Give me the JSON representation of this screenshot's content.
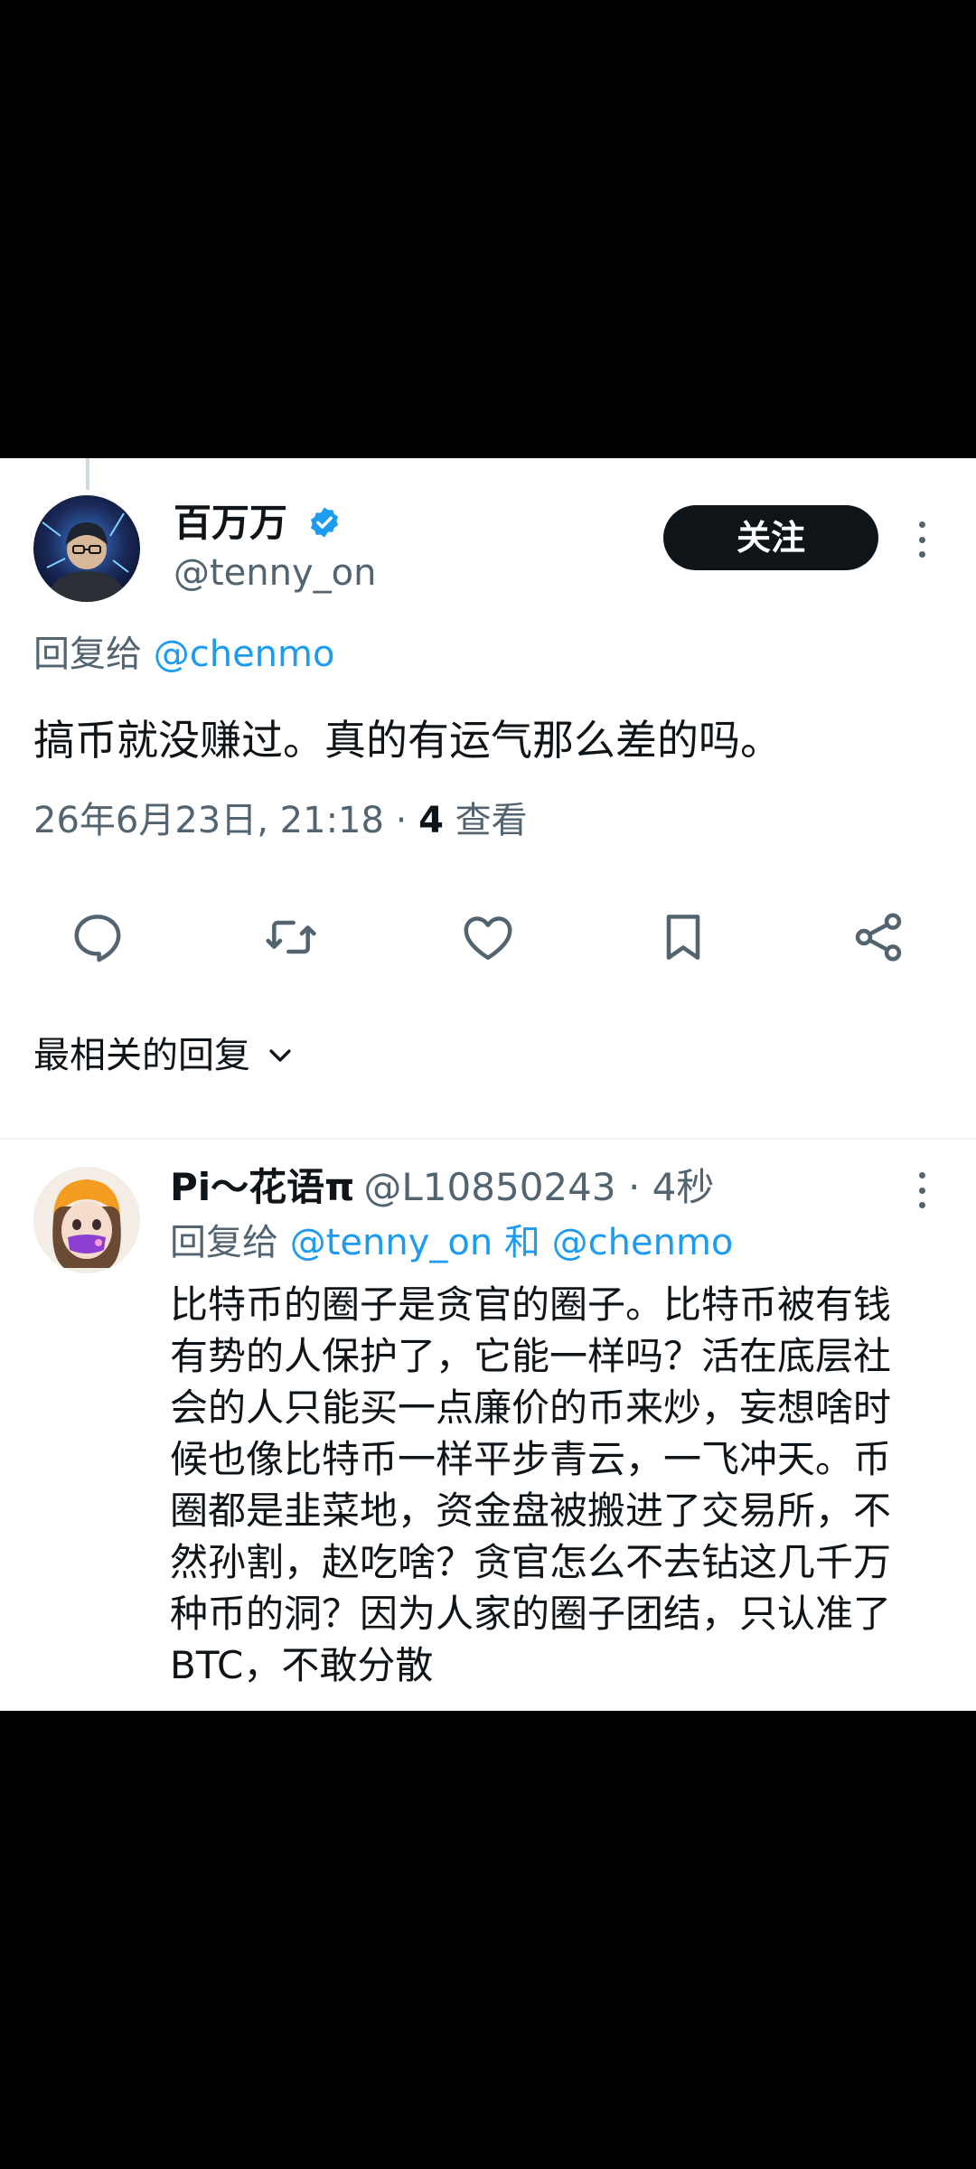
{
  "tweet": {
    "display_name": "百万万",
    "handle": "@tenny_on",
    "follow_label": "关注",
    "reply_to_prefix": "回复给",
    "reply_to_handle": "@chenmo",
    "text": "搞币就没赚过。真的有运气那么差的吗。",
    "timestamp": "26年6月23日, 21:18 · ",
    "views_count": "4",
    "views_label": " 查看",
    "actions": [
      "reply-icon",
      "retweet-icon",
      "like-icon",
      "bookmark-icon",
      "share-icon"
    ]
  },
  "sort": {
    "label": "最相关的回复"
  },
  "reply": {
    "display_name": "Pi～花语π",
    "handle": "@L10850243",
    "time": "· 4秒",
    "reply_to_prefix": "回复给",
    "reply_to_handle1": "@tenny_on",
    "reply_to_and": " 和 ",
    "reply_to_handle2": "@chenmo",
    "text_lines": [
      "比特币的圈子是贪官的圈子。比特币被有钱",
      "有势的人保护了，它能一样吗？活在底层社",
      "会的人只能买一点廉价的币来炒，妄想啥时",
      "候也像比特币一样平步青云，一飞冲天。币",
      "圈都是韭菜地，资金盘被搬进了交易所，不",
      "然孙割，赵吃啥？贪官怎么不去钻这几千万",
      "种币的洞？因为人家的圈子团结，只认准了",
      "BTC，不敢分散"
    ]
  },
  "colors": {
    "link": "#1d9bf0",
    "text": "#0f1419",
    "secondary": "#536471",
    "verified": "#1d9bf0"
  }
}
